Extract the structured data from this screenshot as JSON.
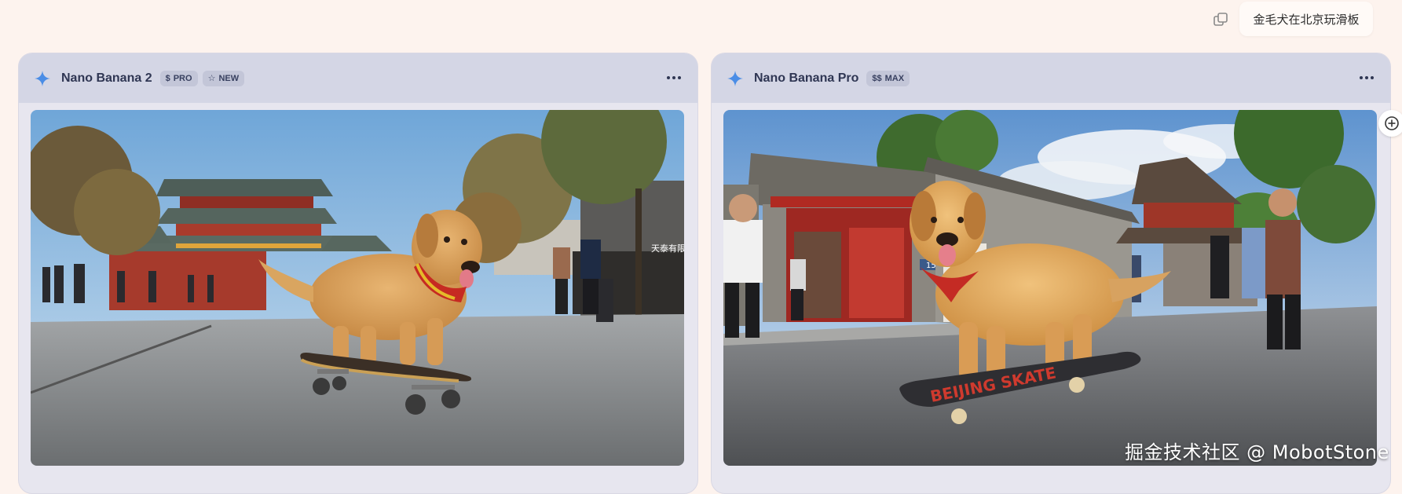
{
  "prompt": {
    "text": "金毛犬在北京玩滑板",
    "copy_icon": "copy-icon"
  },
  "panels": [
    {
      "model_name": "Nano Banana 2",
      "badges": [
        {
          "icon": "$",
          "label": "PRO"
        },
        {
          "icon": "☆",
          "label": "NEW"
        }
      ],
      "more_icon": "more-horizontal-icon",
      "image_alt": "Golden retriever riding a skateboard in front of a traditional Beijing drum tower"
    },
    {
      "model_name": "Nano Banana Pro",
      "badges": [
        {
          "icon": "$$",
          "label": "MAX"
        }
      ],
      "more_icon": "more-horizontal-icon",
      "image_alt": "Golden retriever with red scarf standing on a skateboard in a Beijing hutong street"
    }
  ],
  "skateboard_text": "BEIJING SKATE",
  "plate_number": "15",
  "shop_sign": "天泰有限",
  "watermark": "掘金技术社区 @ MobotStone",
  "colors": {
    "accent_sparkle": "#4a8de6",
    "page_bg": "#fdf3ee",
    "panel_header": "#d4d6e5"
  }
}
